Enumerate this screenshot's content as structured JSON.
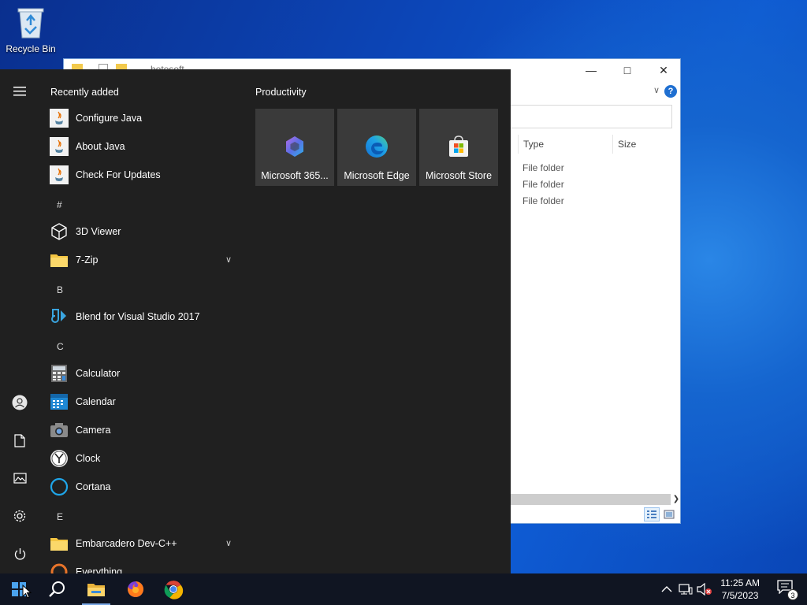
{
  "desktop": {
    "recycle_bin_label": "Recycle Bin"
  },
  "explorer": {
    "title": "botosoft",
    "columns": [
      "Type",
      "Size"
    ],
    "rows": [
      {
        "type": "File folder"
      },
      {
        "type": "File folder"
      },
      {
        "type": "File folder"
      }
    ],
    "help_label": "?"
  },
  "start_menu": {
    "recently_added_title": "Recently added",
    "recent": [
      {
        "name": "Configure Java",
        "icon": "java-icon"
      },
      {
        "name": "About Java",
        "icon": "java-icon"
      },
      {
        "name": "Check For Updates",
        "icon": "java-icon"
      }
    ],
    "groups": [
      {
        "letter": "#",
        "apps": [
          {
            "name": "3D Viewer",
            "icon": "cube-icon"
          },
          {
            "name": "7-Zip",
            "icon": "folder-icon",
            "expandable": true
          }
        ]
      },
      {
        "letter": "B",
        "apps": [
          {
            "name": "Blend for Visual Studio 2017",
            "icon": "blend-icon"
          }
        ]
      },
      {
        "letter": "C",
        "apps": [
          {
            "name": "Calculator",
            "icon": "calculator-icon"
          },
          {
            "name": "Calendar",
            "icon": "calendar-icon"
          },
          {
            "name": "Camera",
            "icon": "camera-icon"
          },
          {
            "name": "Clock",
            "icon": "clock-icon"
          },
          {
            "name": "Cortana",
            "icon": "cortana-icon"
          }
        ]
      },
      {
        "letter": "E",
        "apps": [
          {
            "name": "Embarcadero Dev-C++",
            "icon": "folder-icon",
            "expandable": true
          },
          {
            "name": "Everything",
            "icon": "everything-icon"
          }
        ]
      }
    ],
    "tile_group_title": "Productivity",
    "tiles": [
      {
        "label": "Microsoft 365...",
        "icon": "microsoft-365-icon"
      },
      {
        "label": "Microsoft Edge",
        "icon": "edge-icon"
      },
      {
        "label": "Microsoft Store",
        "icon": "store-icon"
      }
    ]
  },
  "taskbar": {
    "apps": [
      "start-icon",
      "search-icon",
      "file-explorer-icon",
      "firefox-icon",
      "chrome-icon"
    ],
    "time": "11:25 AM",
    "date": "7/5/2023",
    "notification_count": "3"
  },
  "colors": {
    "start_bg": "#202020",
    "tile_bg": "#3a3a3a",
    "taskbar_bg": "#101522",
    "accent": "#1f6fd1"
  }
}
